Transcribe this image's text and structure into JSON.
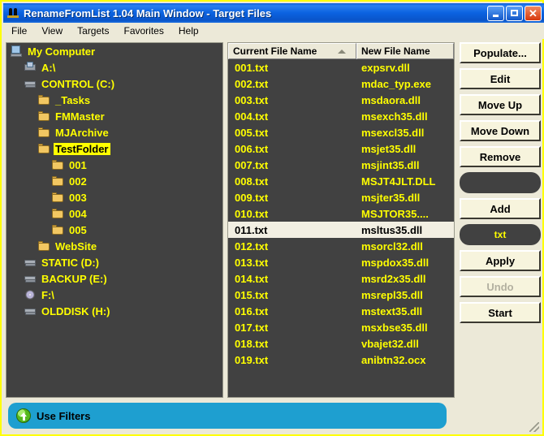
{
  "window": {
    "title": "RenameFromList 1.04 Main Window - Target Files",
    "icon": "app-icon",
    "minimize_label": "",
    "maximize_label": "",
    "close_label": "✕"
  },
  "menu": {
    "items": [
      {
        "label": "File"
      },
      {
        "label": "View"
      },
      {
        "label": "Targets"
      },
      {
        "label": "Favorites"
      },
      {
        "label": "Help"
      }
    ]
  },
  "tree": {
    "nodes": [
      {
        "label": "My Computer",
        "icon": "computer-icon",
        "indent": 0,
        "selected": false
      },
      {
        "label": "A:\\",
        "icon": "floppy-icon",
        "indent": 1,
        "selected": false
      },
      {
        "label": "CONTROL (C:)",
        "icon": "harddrive-icon",
        "indent": 1,
        "selected": false
      },
      {
        "label": "_Tasks",
        "icon": "folder-icon",
        "indent": 2,
        "selected": false
      },
      {
        "label": "FMMaster",
        "icon": "folder-icon",
        "indent": 2,
        "selected": false
      },
      {
        "label": "MJArchive",
        "icon": "folder-icon",
        "indent": 2,
        "selected": false
      },
      {
        "label": "TestFolder",
        "icon": "folder-icon",
        "indent": 2,
        "selected": true
      },
      {
        "label": "001",
        "icon": "folder-icon",
        "indent": 3,
        "selected": false
      },
      {
        "label": "002",
        "icon": "folder-icon",
        "indent": 3,
        "selected": false
      },
      {
        "label": "003",
        "icon": "folder-icon",
        "indent": 3,
        "selected": false
      },
      {
        "label": "004",
        "icon": "folder-icon",
        "indent": 3,
        "selected": false
      },
      {
        "label": "005",
        "icon": "folder-icon",
        "indent": 3,
        "selected": false
      },
      {
        "label": "WebSite",
        "icon": "folder-icon",
        "indent": 2,
        "selected": false
      },
      {
        "label": "STATIC (D:)",
        "icon": "harddrive-icon",
        "indent": 1,
        "selected": false
      },
      {
        "label": "BACKUP (E:)",
        "icon": "harddrive-icon",
        "indent": 1,
        "selected": false
      },
      {
        "label": "F:\\",
        "icon": "cd-icon",
        "indent": 1,
        "selected": false
      },
      {
        "label": "OLDDISK (H:)",
        "icon": "harddrive-icon",
        "indent": 1,
        "selected": false
      }
    ]
  },
  "filelist": {
    "columns": [
      {
        "label": "Current File Name",
        "sorted": true,
        "sort_direction": "asc"
      },
      {
        "label": "New File Name",
        "sorted": false
      }
    ],
    "rows": [
      {
        "current": "001.txt",
        "new": "expsrv.dll",
        "selected": false
      },
      {
        "current": "002.txt",
        "new": "mdac_typ.exe",
        "selected": false
      },
      {
        "current": "003.txt",
        "new": "msdaora.dll",
        "selected": false
      },
      {
        "current": "004.txt",
        "new": "msexch35.dll",
        "selected": false
      },
      {
        "current": "005.txt",
        "new": "msexcl35.dll",
        "selected": false
      },
      {
        "current": "006.txt",
        "new": "msjet35.dll",
        "selected": false
      },
      {
        "current": "007.txt",
        "new": "msjint35.dll",
        "selected": false
      },
      {
        "current": "008.txt",
        "new": "MSJT4JLT.DLL",
        "selected": false
      },
      {
        "current": "009.txt",
        "new": "msjter35.dll",
        "selected": false
      },
      {
        "current": "010.txt",
        "new": "MSJTOR35....",
        "selected": false
      },
      {
        "current": "011.txt",
        "new": "msltus35.dll",
        "selected": true
      },
      {
        "current": "012.txt",
        "new": "msorcl32.dll",
        "selected": false
      },
      {
        "current": "013.txt",
        "new": "mspdox35.dll",
        "selected": false
      },
      {
        "current": "014.txt",
        "new": "msrd2x35.dll",
        "selected": false
      },
      {
        "current": "015.txt",
        "new": "msrepl35.dll",
        "selected": false
      },
      {
        "current": "016.txt",
        "new": "mstext35.dll",
        "selected": false
      },
      {
        "current": "017.txt",
        "new": "msxbse35.dll",
        "selected": false
      },
      {
        "current": "018.txt",
        "new": "vbajet32.dll",
        "selected": false
      },
      {
        "current": "019.txt",
        "new": "anibtn32.ocx",
        "selected": false
      }
    ]
  },
  "buttons": [
    {
      "label": "Populate...",
      "type": "button",
      "disabled": false
    },
    {
      "label": "Edit",
      "type": "button",
      "disabled": false
    },
    {
      "label": "Move Up",
      "type": "button",
      "disabled": false
    },
    {
      "label": "Move Down",
      "type": "button",
      "disabled": false
    },
    {
      "label": "Remove",
      "type": "button",
      "disabled": false
    },
    {
      "label": "",
      "type": "combo",
      "disabled": false
    },
    {
      "label": "Add",
      "type": "button",
      "disabled": false
    },
    {
      "label": "txt",
      "type": "combo",
      "disabled": false
    },
    {
      "label": "Apply",
      "type": "button",
      "disabled": false
    },
    {
      "label": "Undo",
      "type": "button",
      "disabled": true
    },
    {
      "label": "Start",
      "type": "button",
      "disabled": false
    }
  ],
  "filterbar": {
    "label": "Use Filters",
    "icon": "green-up-arrow-icon"
  },
  "colors": {
    "window_border": "#ffff00",
    "titlebar": "#0b62e0",
    "panel_background": "#414141",
    "list_text": "#ffff00",
    "selection_highlight": "#ffff00",
    "filterbar": "#1e9fd0",
    "face": "#ece9d8",
    "button_face": "#f7f4dd"
  }
}
